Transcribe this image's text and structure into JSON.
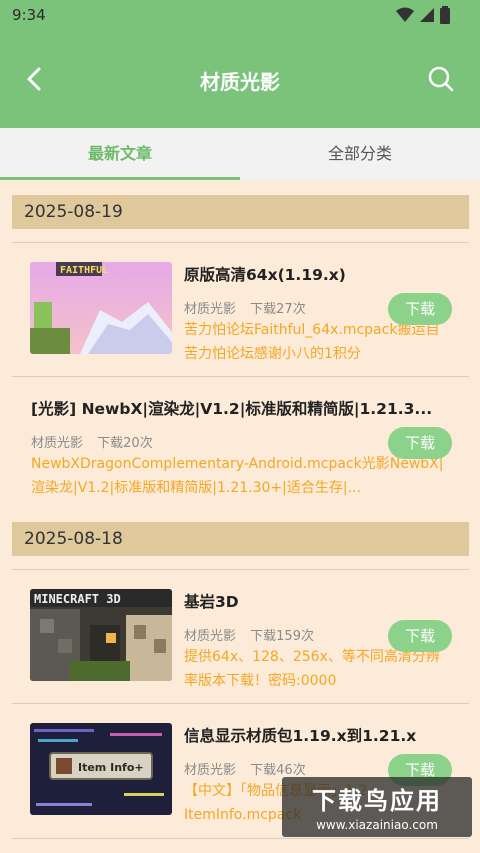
{
  "status": {
    "time": "9:34"
  },
  "header": {
    "title": "材质光影"
  },
  "tabs": [
    {
      "label": "最新文章"
    },
    {
      "label": "全部分类"
    }
  ],
  "sections": [
    {
      "date": "2025-08-19",
      "items": [
        {
          "thumb_text": "FAITHFUL",
          "title": "原版高清64x(1.19.x)",
          "category": "材质光影",
          "downloads": "下载27次",
          "desc": "苦力怕论坛Faithful_64x.mcpack搬运自苦力怕论坛感谢小八的1积分",
          "button": "下载"
        },
        {
          "title": "[光影] NewbX|渲染龙|V1.2|标准版和精简版|1.21.3...",
          "category": "材质光影",
          "downloads": "下载20次",
          "desc": "NewbXDragonComplementary-Android.mcpack光影NewbX|渲染龙|V1.2|标准版和精简版|1.21.30+|适合生存|...",
          "button": "下载"
        }
      ]
    },
    {
      "date": "2025-08-18",
      "items": [
        {
          "thumb_text": "MINECRAFT 3D",
          "title": "基岩3D",
          "category": "材质光影",
          "downloads": "下载159次",
          "desc": "提供64x、128、256x、等不同高清分辨率版本下载！密码:0000",
          "button": "下载"
        },
        {
          "thumb_text": "Item Info+",
          "title": "信息显示材质包1.19.x到1.21.x",
          "category": "材质光影",
          "downloads": "下载46次",
          "desc": "【中文】「物品信息显示」1.2 ItemInfo.mcpack",
          "button": "下载"
        }
      ]
    }
  ],
  "watermark": {
    "line1": "下载鸟应用",
    "line2": "www.xiazainiao.com"
  }
}
